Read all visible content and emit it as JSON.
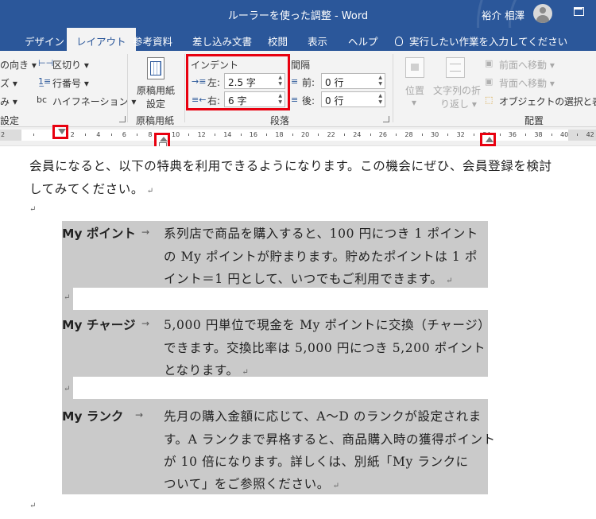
{
  "titlebar": {
    "title": "ルーラーを使った調整  -  Word",
    "user": "裕介 相澤"
  },
  "tabs": {
    "design": "デザイン",
    "layout": "レイアウト",
    "references": "参考資料",
    "mailings": "差し込み文書",
    "review": "校閲",
    "view": "表示",
    "help": "ヘルプ",
    "tell_me": "実行したい作業を入力してください"
  },
  "ribbon": {
    "page_setup": {
      "orientation": "の向き",
      "size": "ズ",
      "columns": "み",
      "breaks": "区切り",
      "line_numbers": "行番号",
      "hyphenation": "ハイフネーション",
      "label": "設定"
    },
    "manuscript": {
      "button": "原稿用紙",
      "button2": "設定",
      "label": "原稿用紙"
    },
    "indent": {
      "title": "インデント",
      "left_label": "左:",
      "left_value": "2.5 字",
      "right_label": "右:",
      "right_value": "6 字"
    },
    "spacing": {
      "title": "間隔",
      "before_label": "前:",
      "before_value": "0 行",
      "after_label": "後:",
      "after_value": "0 行"
    },
    "paragraph_label": "段落",
    "arrange": {
      "position": "位置",
      "wrap": "文字列の折",
      "wrap2": "り返し",
      "bring_forward": "前面へ移動",
      "send_backward": "背面へ移動",
      "selection_pane": "オブジェクトの選択と表示",
      "label": "配置"
    }
  },
  "ruler": {
    "numbers_left": [
      "2"
    ],
    "numbers": [
      "2",
      "4",
      "6",
      "8",
      "10",
      "12",
      "14",
      "16",
      "18",
      "20",
      "22",
      "24",
      "26",
      "28",
      "30",
      "32",
      "34",
      "36",
      "38",
      "40",
      "42"
    ]
  },
  "document": {
    "intro_line1": "会員になると、以下の特典を利用できるようになります。この機会にぜひ、会員登録を検討",
    "intro_line2": "してみてください。",
    "items": [
      {
        "term": "My ポイント",
        "lines": [
          "系列店で商品を購入すると、100 円につき 1 ポイント",
          "の My ポイントが貯まります。貯めたポイントは 1 ポ",
          "イント＝1 円として、いつでもご利用できます。"
        ]
      },
      {
        "term": "My チャージ",
        "lines": [
          "5,000 円単位で現金を My ポイントに交換（チャージ）",
          "できます。交換比率は 5,000 円につき 5,200 ポイント",
          "となります。"
        ]
      },
      {
        "term": "My ランク",
        "lines": [
          "先月の購入金額に応じて、A～D のランクが設定されま",
          "す。A ランクまで昇格すると、商品購入時の獲得ポイント",
          "が 10 倍になります。詳しくは、別紙「My ランクに",
          "ついて」をご参照ください。"
        ]
      }
    ]
  },
  "colors": {
    "brand": "#2b579a",
    "highlight": "#e8000f",
    "shading": "#cacaca"
  }
}
